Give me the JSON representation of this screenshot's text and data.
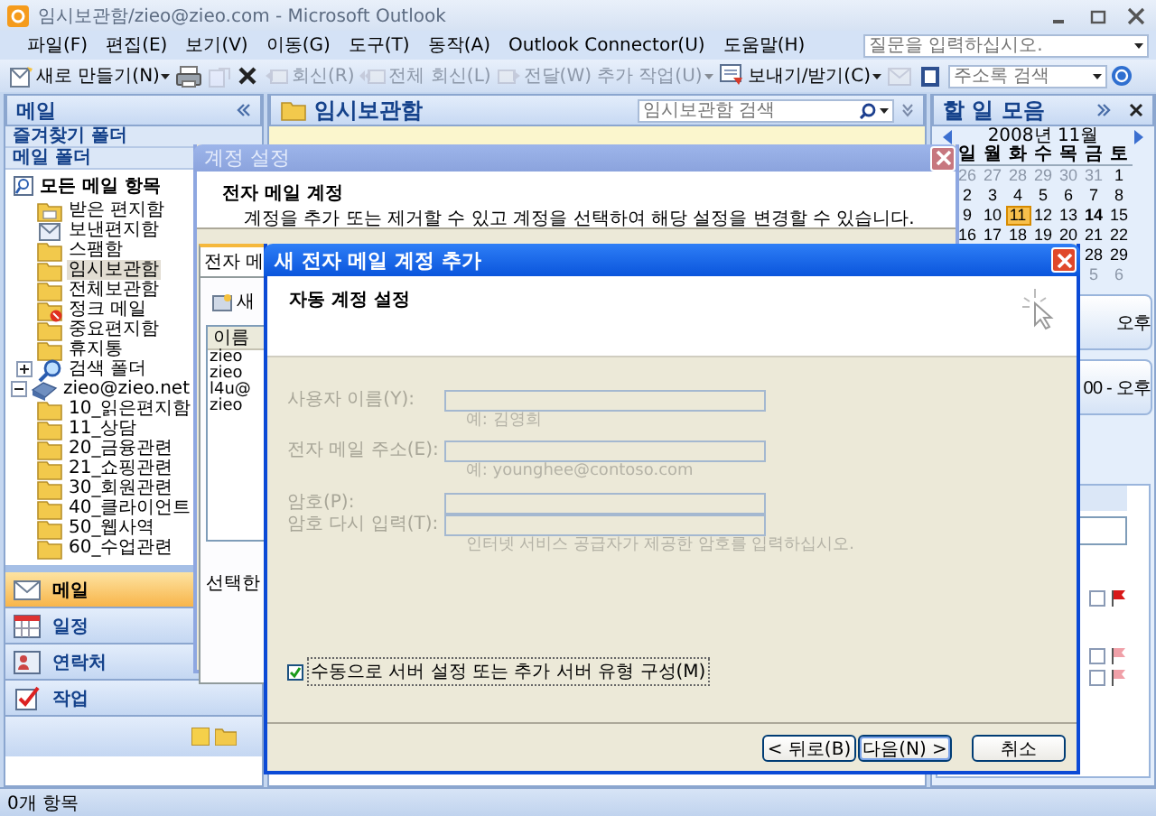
{
  "window": {
    "title": "임시보관함/zieo@zieo.com - Microsoft Outlook"
  },
  "menu": [
    "파일(F)",
    "편집(E)",
    "보기(V)",
    "이동(G)",
    "도구(T)",
    "동작(A)",
    "Outlook Connector(U)",
    "도움말(H)"
  ],
  "help_field": {
    "placeholder": "질문을 입력하십시오."
  },
  "toolbar": [
    {
      "kind": "new",
      "label": "새로 만들기(N)",
      "disabled": false
    },
    {
      "kind": "print",
      "disabled": false
    },
    {
      "kind": "move",
      "disabled": true
    },
    {
      "kind": "delete",
      "disabled": false
    },
    {
      "kind": "reply",
      "label": "회신(R)",
      "disabled": true
    },
    {
      "kind": "reply-all",
      "label": "전체 회신(L)",
      "disabled": true
    },
    {
      "kind": "forward",
      "label": "전달(W)",
      "disabled": true
    },
    {
      "kind": "more",
      "label": "추가 작업(U)",
      "disabled": true
    },
    {
      "kind": "send-receive",
      "label": "보내기/받기(C)",
      "disabled": false
    },
    {
      "kind": "sync",
      "disabled": true
    },
    {
      "kind": "address-book",
      "disabled": false
    }
  ],
  "address_search": {
    "placeholder": "주소록 검색"
  },
  "nav": {
    "title": "메일",
    "favorites_header": "즐겨찾기 폴더",
    "folders_header": "메일 폴더",
    "all_items": "모든 메일 항목",
    "tree": [
      {
        "kind": "inbox",
        "label": "받은 편지함",
        "selected": false
      },
      {
        "kind": "sent",
        "label": "보낸편지함",
        "selected": false
      },
      {
        "kind": "folder",
        "label": "스팸함",
        "selected": false
      },
      {
        "kind": "folder",
        "label": "임시보관함",
        "selected": true
      },
      {
        "kind": "folder",
        "label": "전체보관함",
        "selected": false
      },
      {
        "kind": "junk",
        "label": "정크 메일",
        "selected": false
      },
      {
        "kind": "folder",
        "label": "중요편지함",
        "selected": false
      },
      {
        "kind": "folder",
        "label": "휴지통",
        "selected": false
      },
      {
        "kind": "search",
        "label": "검색 폴더",
        "selected": false,
        "expanded": false
      },
      {
        "kind": "account",
        "label": "zieo@zieo.net",
        "selected": false,
        "expanded": true,
        "children": [
          {
            "kind": "folder",
            "label": "10_읽은편지함",
            "selected": false
          },
          {
            "kind": "folder",
            "label": "11_상담",
            "selected": false
          },
          {
            "kind": "folder",
            "label": "20_금융관련",
            "selected": false
          },
          {
            "kind": "folder",
            "label": "21_쇼핑관련",
            "selected": false
          },
          {
            "kind": "folder",
            "label": "30_회원관련",
            "selected": false
          },
          {
            "kind": "folder",
            "label": "40_클라이언트",
            "selected": false
          },
          {
            "kind": "folder",
            "label": "50_웹사역",
            "selected": false
          },
          {
            "kind": "folder",
            "label": "60_수업관련",
            "selected": false
          }
        ]
      }
    ],
    "buttons": [
      {
        "kind": "mail",
        "label": "메일",
        "selected": true
      },
      {
        "kind": "calendar",
        "label": "일정",
        "selected": false
      },
      {
        "kind": "contacts",
        "label": "연락처",
        "selected": false
      },
      {
        "kind": "tasks",
        "label": "작업",
        "selected": false
      }
    ]
  },
  "folder_view": {
    "title": "임시보관함",
    "search": {
      "placeholder": "임시보관함 검색"
    }
  },
  "todo": {
    "title": "할 일 모음",
    "calendar": {
      "month": "2008년 11월",
      "weekdays": [
        "일",
        "월",
        "화",
        "수",
        "목",
        "금",
        "토"
      ],
      "weeks": [
        [
          {
            "day": "26",
            "kind": "other"
          },
          {
            "day": "27",
            "kind": "other"
          },
          {
            "day": "28",
            "kind": "other"
          },
          {
            "day": "29",
            "kind": "other"
          },
          {
            "day": "30",
            "kind": "other"
          },
          {
            "day": "31",
            "kind": "other"
          },
          {
            "day": "1",
            "kind": "normal"
          }
        ],
        [
          {
            "day": "2",
            "kind": "normal"
          },
          {
            "day": "3",
            "kind": "normal"
          },
          {
            "day": "4",
            "kind": "normal"
          },
          {
            "day": "5",
            "kind": "normal"
          },
          {
            "day": "6",
            "kind": "normal"
          },
          {
            "day": "7",
            "kind": "normal"
          },
          {
            "day": "8",
            "kind": "normal"
          }
        ],
        [
          {
            "day": "9",
            "kind": "normal"
          },
          {
            "day": "10",
            "kind": "normal"
          },
          {
            "day": "11",
            "kind": "today"
          },
          {
            "day": "12",
            "kind": "normal"
          },
          {
            "day": "13",
            "kind": "normal"
          },
          {
            "day": "14",
            "kind": "bold"
          },
          {
            "day": "15",
            "kind": "normal"
          }
        ],
        [
          {
            "day": "16",
            "kind": "normal"
          },
          {
            "day": "17",
            "kind": "normal"
          },
          {
            "day": "18",
            "kind": "normal"
          },
          {
            "day": "19",
            "kind": "normal"
          },
          {
            "day": "20",
            "kind": "normal"
          },
          {
            "day": "21",
            "kind": "normal"
          },
          {
            "day": "22",
            "kind": "normal"
          }
        ],
        [
          {
            "day": "28",
            "kind": "normal"
          },
          {
            "day": "29",
            "kind": "normal"
          }
        ],
        [
          {
            "day": "5",
            "kind": "other"
          },
          {
            "day": "6",
            "kind": "other"
          }
        ]
      ]
    },
    "appointments": [
      {
        "lines": [
          "오후"
        ]
      },
      {
        "lines": [
          "00 - 오후"
        ]
      }
    ],
    "tasks": [
      {
        "checked": false,
        "color": "#d81818"
      },
      {
        "checked": false,
        "color": "#f0a0a8"
      },
      {
        "checked": false,
        "color": "#f0a0a8"
      }
    ]
  },
  "status_bar": {
    "text": "0개 항목"
  },
  "account_settings": {
    "title": "계정 설정",
    "heading": "전자 메일 계정",
    "description": "계정을 추가 또는 제거할 수 있고 계정을 선택하여 해당 설정을 변경할 수 있습니다.",
    "tab": "전자 메",
    "new_button": "새",
    "column": "이름",
    "accounts": [
      "zieo",
      "zieo",
      "l4u@",
      "zieo"
    ],
    "footer_text": "선택한"
  },
  "new_account": {
    "title": "새 전자 메일 계정 추가",
    "heading": "자동 계정 설정",
    "fields": [
      {
        "label": "사용자 이름(Y):",
        "hint": "예: 김영희",
        "disabled": true
      },
      {
        "label": "전자 메일 주소(E):",
        "hint": "예: younghee@contoso.com",
        "disabled": true
      },
      {
        "label": "암호(P):",
        "disabled": true
      },
      {
        "label": "암호 다시 입력(T):",
        "hint": "인터넷 서비스 공급자가 제공한 암호를 입력하십시오.",
        "disabled": true
      }
    ],
    "manual": {
      "label": "수동으로 서버 설정 또는 추가 서버 유형 구성(M)",
      "checked": true
    },
    "buttons": [
      {
        "label": "< 뒤로(B)",
        "default": false
      },
      {
        "label": "다음(N) >",
        "default": true
      },
      {
        "label": "취소",
        "default": false
      }
    ]
  }
}
